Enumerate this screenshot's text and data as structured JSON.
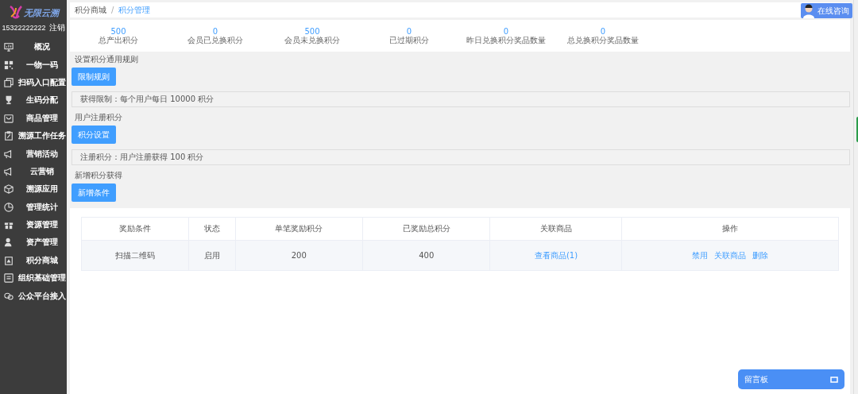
{
  "sidebar": {
    "logo_text": "无限云溯",
    "phone": "15322222222",
    "logout": "注销",
    "items": [
      {
        "label": "概况"
      },
      {
        "label": "一物一码"
      },
      {
        "label": "扫码入口配置"
      },
      {
        "label": "生码分配"
      },
      {
        "label": "商品管理"
      },
      {
        "label": "溯源工作任务"
      },
      {
        "label": "营销活动"
      },
      {
        "label": "云营销"
      },
      {
        "label": "溯源应用"
      },
      {
        "label": "管理统计"
      },
      {
        "label": "资源管理"
      },
      {
        "label": "资产管理"
      },
      {
        "label": "积分商城"
      },
      {
        "label": "组织基础管理"
      },
      {
        "label": "公众平台接入"
      }
    ]
  },
  "breadcrumb_separator": "/",
  "breadcrumb": [
    {
      "label": "积分商城",
      "selected": false
    },
    {
      "label": "积分管理",
      "selected": true
    }
  ],
  "stats": [
    {
      "value": "500",
      "label": "总产出积分"
    },
    {
      "value": "0",
      "label": "会员已兑换积分"
    },
    {
      "value": "500",
      "label": "会员未兑换积分"
    },
    {
      "value": "0",
      "label": "已过期积分"
    },
    {
      "value": "0",
      "label": "昨日兑换积分奖品数量"
    },
    {
      "value": "0",
      "label": "总兑换积分奖品数量"
    }
  ],
  "sections": [
    {
      "title": "设置积分通用规则",
      "button": "限制规则",
      "info": "获得限制：每个用户每日 10000 积分"
    },
    {
      "title": "用户注册积分",
      "button": "积分设置",
      "info": "注册积分：用户注册获得 100 积分"
    },
    {
      "title": "新增积分获得",
      "button": "新增条件"
    }
  ],
  "table": {
    "columns": [
      "奖励条件",
      "状态",
      "单笔奖励积分",
      "已奖励总积分",
      "关联商品",
      "操作"
    ],
    "rows": [
      {
        "cells": [
          "扫描二维码",
          "启用",
          "200",
          "400"
        ],
        "link": "查看商品(1)",
        "actions": [
          "禁用",
          "关联商品",
          "删除"
        ]
      }
    ]
  },
  "consult_button": "在线咨询",
  "message_board": "留言板"
}
